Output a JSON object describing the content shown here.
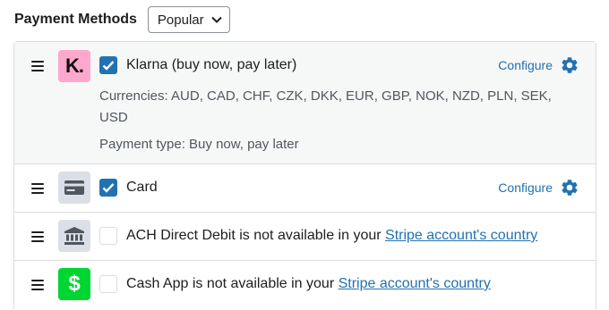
{
  "header": {
    "title": "Payment Methods",
    "filter_value": "Popular"
  },
  "methods": [
    {
      "name": "Klarna (buy now, pay later)",
      "logo_letter": "K.",
      "checked": true,
      "configure_label": "Configure",
      "currencies": "Currencies: AUD, CAD, CHF, CZK, DKK, EUR, GBP, NOK, NZD, PLN, SEK, USD",
      "payment_type": "Payment type: Buy now, pay later"
    },
    {
      "name": "Card",
      "checked": true,
      "configure_label": "Configure"
    },
    {
      "text": "ACH Direct Debit is not available in your ",
      "link": "Stripe account's country",
      "checked": false
    },
    {
      "text": "Cash App is not available in your ",
      "link": "Stripe account's country",
      "checked": false,
      "logo_letter": "$"
    }
  ],
  "colors": {
    "accent": "#2271b1",
    "klarna_pink": "#ffa8cd",
    "cash_app_green": "#00d632",
    "icon_bg": "#dcdfe6",
    "icon_fg": "#50575e",
    "border": "#dcdcde"
  },
  "icons": [
    "drag-handle-icon",
    "klarna-logo-icon",
    "checkmark-icon",
    "gear-icon",
    "credit-card-icon",
    "bank-icon",
    "cash-app-logo-icon",
    "chevron-down-icon"
  ]
}
